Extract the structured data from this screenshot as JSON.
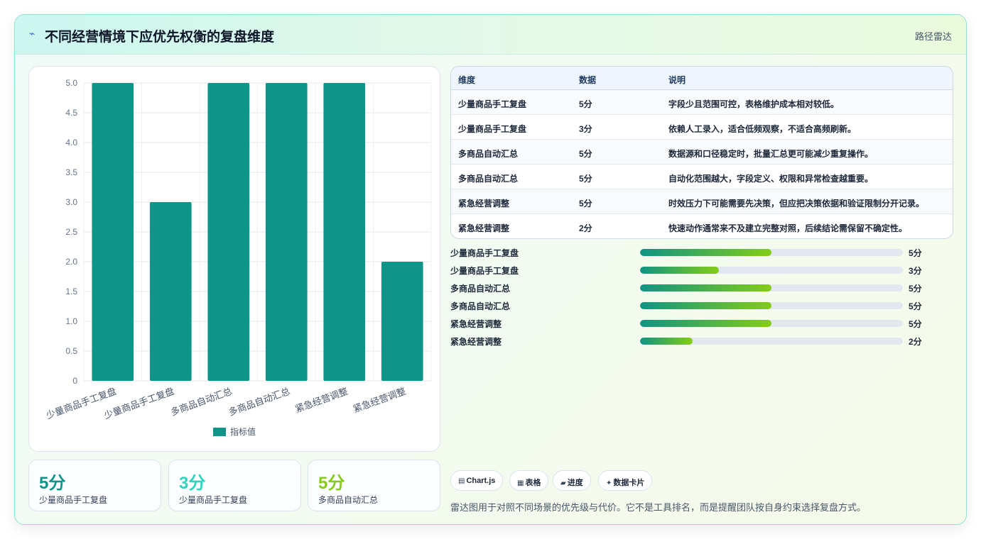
{
  "header": {
    "icon": "bolt-icon",
    "title": "不同经营情境下应优先权衡的复盘维度",
    "tag": "路径雷达"
  },
  "chart_data": {
    "type": "bar",
    "categories": [
      "少量商品手工复盘",
      "少量商品手工复盘",
      "多商品自动汇总",
      "多商品自动汇总",
      "紧急经营调整",
      "紧急经营调整"
    ],
    "series": [
      {
        "name": "指标值",
        "values": [
          5,
          3,
          5,
          5,
          5,
          2
        ],
        "color": "#0e9488"
      }
    ],
    "ylim": [
      0,
      5
    ],
    "yticks": [
      "0",
      "0.5",
      "1.0",
      "1.5",
      "2.0",
      "2.5",
      "3.0",
      "3.5",
      "4.0",
      "4.5",
      "5.0"
    ],
    "legend": "bottom",
    "grid": true
  },
  "table": {
    "headers": [
      "维度",
      "数据",
      "说明"
    ],
    "rows": [
      [
        "少量商品手工复盘",
        "5分",
        "字段少且范围可控，表格维护成本相对较低。"
      ],
      [
        "少量商品手工复盘",
        "3分",
        "依赖人工录入，适合低频观察，不适合高频刷新。"
      ],
      [
        "多商品自动汇总",
        "5分",
        "数据源和口径稳定时，批量汇总更可能减少重复操作。"
      ],
      [
        "多商品自动汇总",
        "5分",
        "自动化范围越大，字段定义、权限和异常检查越重要。"
      ],
      [
        "紧急经营调整",
        "5分",
        "时效压力下可能需要先决策，但应把决策依据和验证限制分开记录。"
      ],
      [
        "紧急经营调整",
        "2分",
        "快速动作通常来不及建立完整对照，后续结论需保留不确定性。"
      ]
    ]
  },
  "progress": [
    {
      "label": "少量商品手工复盘",
      "value": 5,
      "max": 10,
      "text": "5分"
    },
    {
      "label": "少量商品手工复盘",
      "value": 3,
      "max": 10,
      "text": "3分"
    },
    {
      "label": "多商品自动汇总",
      "value": 5,
      "max": 10,
      "text": "5分"
    },
    {
      "label": "多商品自动汇总",
      "value": 5,
      "max": 10,
      "text": "5分"
    },
    {
      "label": "紧急经营调整",
      "value": 5,
      "max": 10,
      "text": "5分"
    },
    {
      "label": "紧急经营调整",
      "value": 2,
      "max": 10,
      "text": "2分"
    }
  ],
  "stats": [
    {
      "value": "5分",
      "label": "少量商品手工复盘",
      "color": "#0e9488"
    },
    {
      "value": "3分",
      "label": "少量商品手工复盘",
      "color": "#2dd4bf"
    },
    {
      "value": "5分",
      "label": "多商品自动汇总",
      "color": "#84cc16"
    }
  ],
  "chips": [
    {
      "icon": "chart-icon",
      "label": "Chart.js"
    },
    {
      "icon": "table-icon",
      "label": "表格"
    },
    {
      "icon": "progress-icon",
      "label": "进度"
    },
    {
      "icon": "sparkle-icon",
      "label": "数据卡片"
    }
  ],
  "note": "雷达图用于对照不同场景的优先级与代价。它不是工具排名，而是提醒团队按自身约束选择复盘方式。"
}
